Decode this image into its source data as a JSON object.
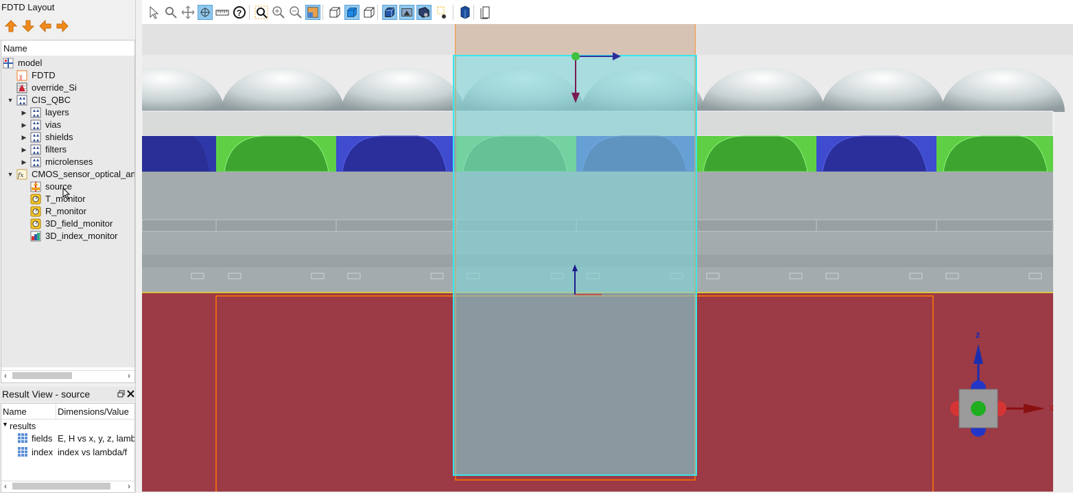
{
  "left_panel": {
    "title": "FDTD Layout",
    "tree_header": "Name",
    "tree": [
      {
        "label": "model",
        "icon": "model-icon",
        "level": 0,
        "expander": ""
      },
      {
        "label": "FDTD",
        "icon": "fdtd-icon",
        "level": 1,
        "expander": ""
      },
      {
        "label": "override_Si",
        "icon": "mesh-override-icon",
        "level": 1,
        "expander": ""
      },
      {
        "label": "CIS_QBC",
        "icon": "group-icon",
        "level": 1,
        "expander": "▼"
      },
      {
        "label": "layers",
        "icon": "group-icon",
        "level": 2,
        "expander": "▶"
      },
      {
        "label": "vias",
        "icon": "group-icon",
        "level": 2,
        "expander": "▶"
      },
      {
        "label": "shields",
        "icon": "group-icon",
        "level": 2,
        "expander": "▶"
      },
      {
        "label": "filters",
        "icon": "group-icon",
        "level": 2,
        "expander": "▶"
      },
      {
        "label": "microlenses",
        "icon": "group-icon",
        "level": 2,
        "expander": "▶"
      },
      {
        "label": "CMOS_sensor_optical_an",
        "icon": "analysis-group-icon",
        "level": 1,
        "expander": "▼"
      },
      {
        "label": "source",
        "icon": "source-icon",
        "level": 2,
        "expander": ""
      },
      {
        "label": "T_monitor",
        "icon": "monitor-icon",
        "level": 2,
        "expander": ""
      },
      {
        "label": "R_monitor",
        "icon": "monitor-icon",
        "level": 2,
        "expander": ""
      },
      {
        "label": "3D_field_monitor",
        "icon": "monitor-icon",
        "level": 2,
        "expander": ""
      },
      {
        "label": "3D_index_monitor",
        "icon": "index-monitor-icon",
        "level": 2,
        "expander": ""
      }
    ]
  },
  "result_view": {
    "title": "Result View - source",
    "col_name": "Name",
    "col_dims": "Dimensions/Value",
    "root": "results",
    "rows": [
      {
        "name": "fields",
        "value": "E, H vs x, y, z, lambda"
      },
      {
        "name": "index",
        "value": "index vs lambda/f"
      }
    ]
  },
  "toolbar": {
    "buttons": [
      "select-tool-icon",
      "zoom-tool-icon",
      "pan-tool-icon",
      "rotate-tool-icon",
      "ruler-tool-icon",
      "help-icon",
      "zoom-region-icon",
      "zoom-in-icon",
      "zoom-out-icon",
      "zoom-extent-icon",
      "view-wireframe-icon",
      "view-solid-icon",
      "view-outline-icon",
      "view-perspective-icon",
      "view-cut-icon",
      "view-camera-icon",
      "view-light-icon",
      "view-3d-box-icon",
      "view-page-icon"
    ]
  },
  "viewport": {
    "axis_z": "z",
    "axis_x": "x",
    "colors": {
      "substrate": "#9c3a45",
      "source_box": "#7fd3d6",
      "filter_blue": "#2c35a8",
      "filter_green": "#3db935",
      "oxide": "#a4abad",
      "orange_outline": "#ff7a00"
    }
  }
}
